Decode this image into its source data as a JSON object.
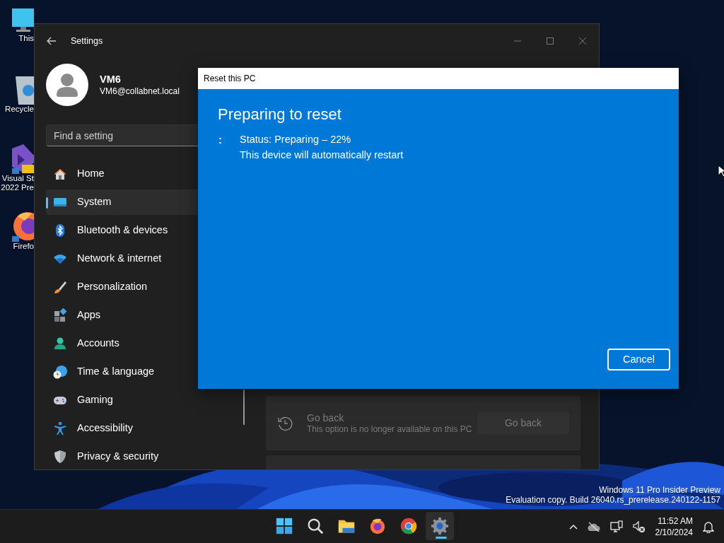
{
  "desktop": {
    "icons": [
      {
        "kind": "pc",
        "lines": [
          "This"
        ]
      },
      {
        "kind": "recycle",
        "lines": [
          "Recycle"
        ]
      },
      {
        "kind": "vs",
        "lines": [
          "Visual St",
          "2022 Pre"
        ]
      },
      {
        "kind": "firefox",
        "lines": [
          "Firefo"
        ]
      }
    ],
    "build_info": [
      "Windows 11 Pro Insider Preview",
      "Evaluation copy. Build 26040.rs_prerelease.240122-1157"
    ]
  },
  "settings_window": {
    "title": "Settings",
    "user": {
      "name": "VM6",
      "email": "VM6@collabnet.local"
    },
    "search": {
      "placeholder": "Find a setting"
    },
    "nav": [
      {
        "kind": "home",
        "label": "Home",
        "selected": false
      },
      {
        "kind": "system",
        "label": "System",
        "selected": true
      },
      {
        "kind": "bluetooth",
        "label": "Bluetooth & devices",
        "selected": false
      },
      {
        "kind": "network",
        "label": "Network & internet",
        "selected": false
      },
      {
        "kind": "personalization",
        "label": "Personalization",
        "selected": false
      },
      {
        "kind": "apps",
        "label": "Apps",
        "selected": false
      },
      {
        "kind": "accounts",
        "label": "Accounts",
        "selected": false
      },
      {
        "kind": "time",
        "label": "Time & language",
        "selected": false
      },
      {
        "kind": "gaming",
        "label": "Gaming",
        "selected": false
      },
      {
        "kind": "accessibility",
        "label": "Accessibility",
        "selected": false
      },
      {
        "kind": "privacy",
        "label": "Privacy & security",
        "selected": false
      }
    ],
    "cards": [
      {
        "title": "Go back",
        "description": "This option is no longer available on this PC",
        "button": {
          "label": "Go back",
          "disabled": true
        }
      }
    ]
  },
  "dialog": {
    "title": "Reset this PC",
    "heading": "Preparing to reset",
    "spinner": ":",
    "status_lines": [
      "Status: Preparing – 22%",
      "This device will automatically restart"
    ],
    "cancel": "Cancel"
  },
  "taskbar": {
    "apps": [
      {
        "kind": "start",
        "active": false
      },
      {
        "kind": "search",
        "active": false
      },
      {
        "kind": "explorer",
        "active": false
      },
      {
        "kind": "firefox",
        "active": false
      },
      {
        "kind": "chrome",
        "active": false
      },
      {
        "kind": "settings",
        "active": true
      }
    ],
    "clock": {
      "time": "11:52 AM",
      "date": "2/10/2024"
    }
  }
}
